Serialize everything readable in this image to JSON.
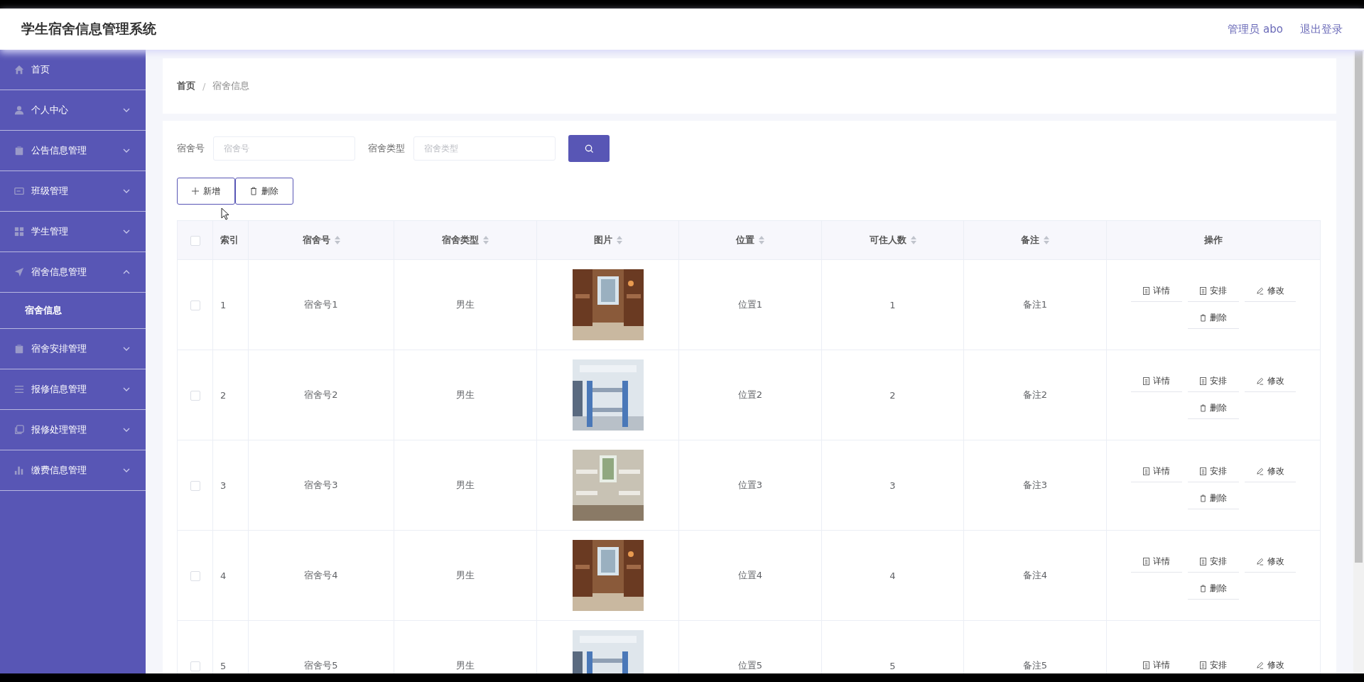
{
  "header": {
    "title": "学生宿舍信息管理系统",
    "user": "管理员 abo",
    "logout": "退出登录"
  },
  "sidebar": {
    "items": [
      {
        "label": "首页",
        "expandable": false
      },
      {
        "label": "个人中心",
        "expandable": true,
        "expanded": false
      },
      {
        "label": "公告信息管理",
        "expandable": true,
        "expanded": false
      },
      {
        "label": "班级管理",
        "expandable": true,
        "expanded": false
      },
      {
        "label": "学生管理",
        "expandable": true,
        "expanded": false
      },
      {
        "label": "宿舍信息管理",
        "expandable": true,
        "expanded": true,
        "children": [
          {
            "label": "宿舍信息",
            "selected": true
          }
        ]
      },
      {
        "label": "宿舍安排管理",
        "expandable": true,
        "expanded": false
      },
      {
        "label": "报修信息管理",
        "expandable": true,
        "expanded": false
      },
      {
        "label": "报修处理管理",
        "expandable": true,
        "expanded": false
      },
      {
        "label": "缴费信息管理",
        "expandable": true,
        "expanded": false
      }
    ]
  },
  "breadcrumb": [
    "首页",
    "宿舍信息"
  ],
  "breadcrumb_separator": "/",
  "search": {
    "fields": [
      {
        "label": "宿舍号",
        "placeholder": "宿舍号"
      },
      {
        "label": "宿舍类型",
        "placeholder": "宿舍类型"
      }
    ]
  },
  "toolbar": [
    {
      "label": "新增",
      "kind": "add"
    },
    {
      "label": "删除",
      "kind": "delete"
    }
  ],
  "table": {
    "all_checked": false,
    "columns": [
      {
        "label": "索引",
        "sortable": false
      },
      {
        "label": "宿舍号",
        "sortable": true
      },
      {
        "label": "宿舍类型",
        "sortable": true
      },
      {
        "label": "图片",
        "sortable": true
      },
      {
        "label": "位置",
        "sortable": true
      },
      {
        "label": "可住人数",
        "sortable": true
      },
      {
        "label": "备注",
        "sortable": true
      },
      {
        "label": "操作",
        "sortable": false
      }
    ],
    "rows": [
      {
        "checked": false,
        "index": "1",
        "number": "宿舍号1",
        "type": "男生",
        "location": "位置1",
        "capacity": "1",
        "note": "备注1",
        "actions": [
          {
            "label": "详情",
            "kind": "doc"
          },
          {
            "label": "安排",
            "kind": "doc"
          },
          {
            "label": "修改",
            "kind": "edit"
          },
          {
            "label": "删除",
            "kind": "delete"
          }
        ]
      },
      {
        "checked": false,
        "index": "2",
        "number": "宿舍号2",
        "type": "男生",
        "location": "位置2",
        "capacity": "2",
        "note": "备注2",
        "actions": [
          {
            "label": "详情",
            "kind": "doc"
          },
          {
            "label": "安排",
            "kind": "doc"
          },
          {
            "label": "修改",
            "kind": "edit"
          },
          {
            "label": "删除",
            "kind": "delete"
          }
        ]
      },
      {
        "checked": false,
        "index": "3",
        "number": "宿舍号3",
        "type": "男生",
        "location": "位置3",
        "capacity": "3",
        "note": "备注3",
        "actions": [
          {
            "label": "详情",
            "kind": "doc"
          },
          {
            "label": "安排",
            "kind": "doc"
          },
          {
            "label": "修改",
            "kind": "edit"
          },
          {
            "label": "删除",
            "kind": "delete"
          }
        ]
      },
      {
        "checked": false,
        "index": "4",
        "number": "宿舍号4",
        "type": "男生",
        "location": "位置4",
        "capacity": "4",
        "note": "备注4",
        "actions": [
          {
            "label": "详情",
            "kind": "doc"
          },
          {
            "label": "安排",
            "kind": "doc"
          },
          {
            "label": "修改",
            "kind": "edit"
          },
          {
            "label": "删除",
            "kind": "delete"
          }
        ]
      },
      {
        "checked": false,
        "index": "5",
        "number": "宿舍号5",
        "type": "男生",
        "location": "位置5",
        "capacity": "5",
        "note": "备注5",
        "actions": [
          {
            "label": "详情",
            "kind": "doc"
          },
          {
            "label": "安排",
            "kind": "doc"
          },
          {
            "label": "修改",
            "kind": "edit"
          }
        ]
      }
    ]
  }
}
